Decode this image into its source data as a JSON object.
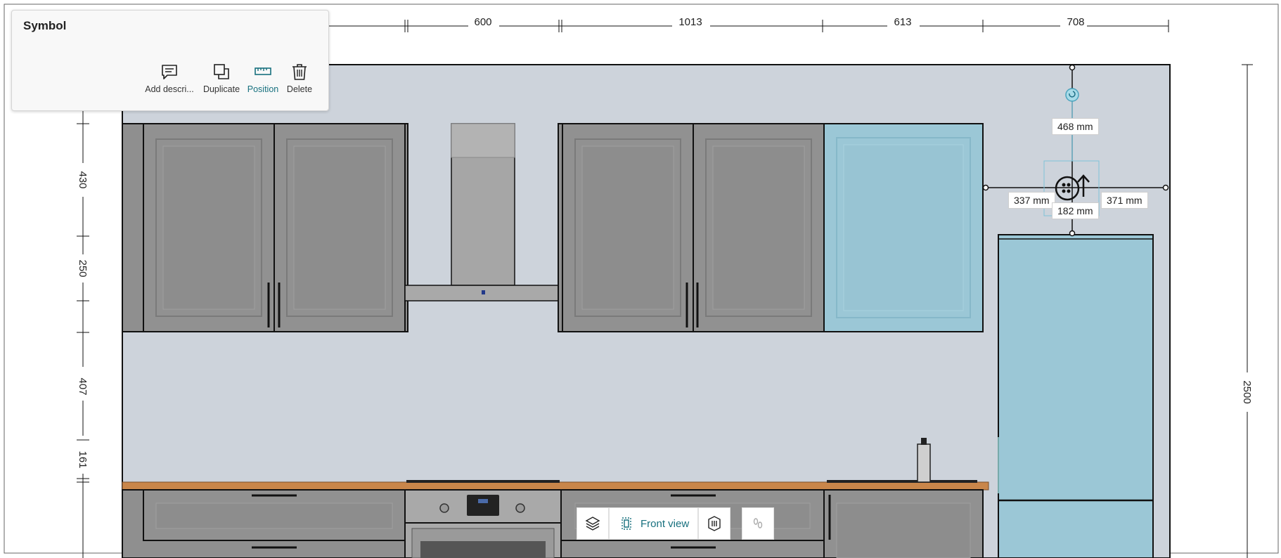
{
  "panel": {
    "title": "Symbol",
    "tools": [
      {
        "label": "Add descri...",
        "icon": "comment-icon"
      },
      {
        "label": "Duplicate",
        "icon": "duplicate-icon"
      },
      {
        "label": "Position",
        "icon": "ruler-icon",
        "active": true
      },
      {
        "label": "Delete",
        "icon": "trash-icon"
      }
    ]
  },
  "dimensions": {
    "top": [
      "600",
      "1013",
      "613",
      "708"
    ],
    "left": [
      "430",
      "250",
      "407",
      "161"
    ],
    "right": "2500"
  },
  "measurements": {
    "above": "468 mm",
    "left": "337 mm",
    "right": "371 mm",
    "below": "182 mm"
  },
  "view": {
    "front_label": "Front view"
  },
  "colors": {
    "wall": "#cdd3db",
    "cabinet": "#8f8f8f",
    "selected": "#9bc7d6",
    "accent": "#17707e",
    "countertop": "#c9864a"
  }
}
